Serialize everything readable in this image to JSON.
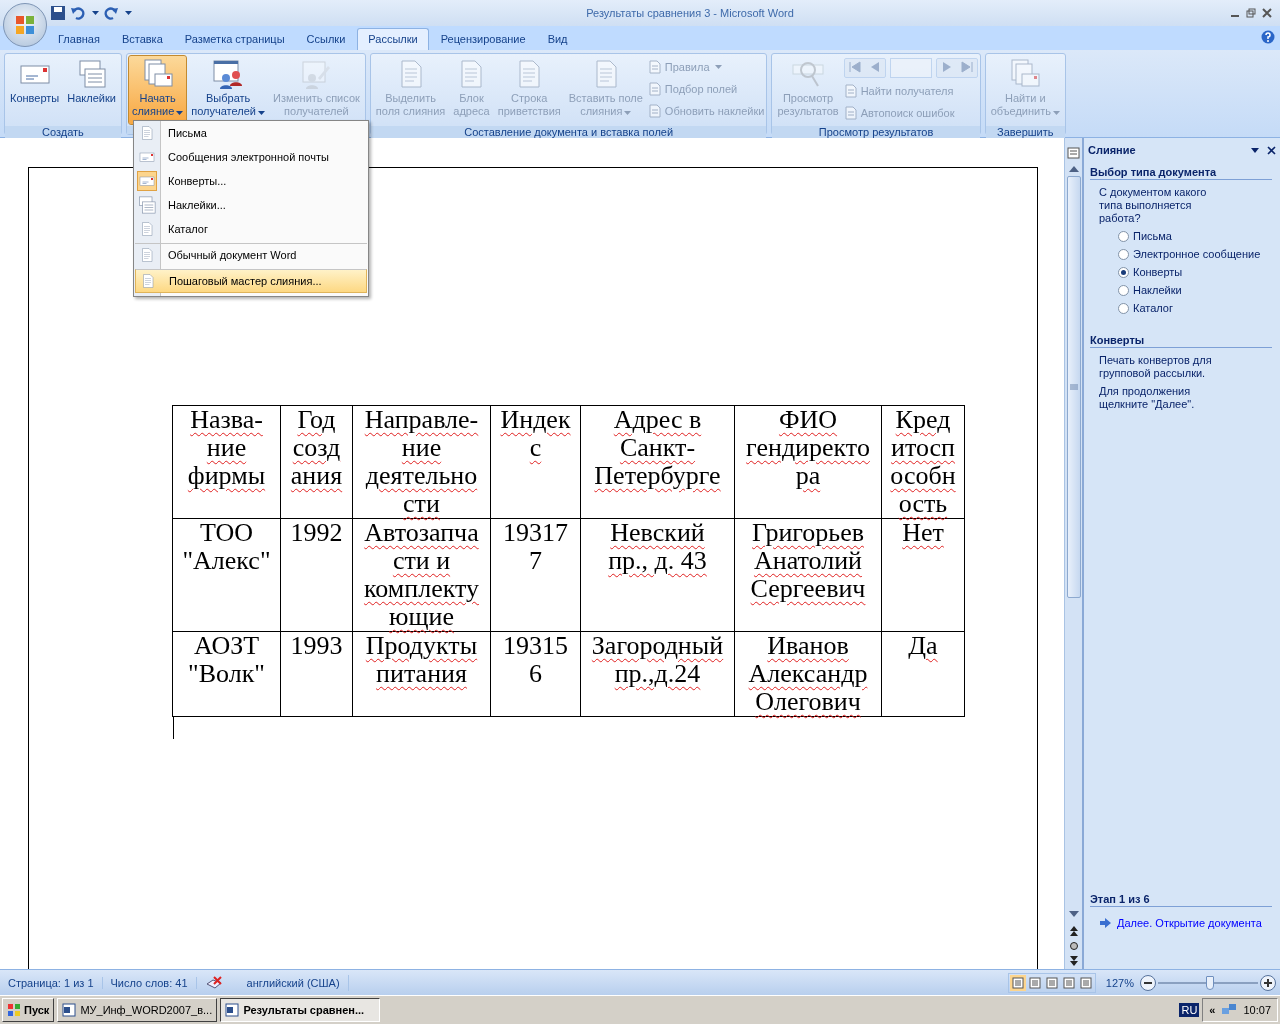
{
  "window": {
    "title": "Результаты сравнения 3 - Microsoft Word"
  },
  "tabs": [
    {
      "label": "Главная",
      "selected": false
    },
    {
      "label": "Вставка",
      "selected": false
    },
    {
      "label": "Разметка страницы",
      "selected": false
    },
    {
      "label": "Ссылки",
      "selected": false
    },
    {
      "label": "Рассылки",
      "selected": true
    },
    {
      "label": "Рецензирование",
      "selected": false
    },
    {
      "label": "Вид",
      "selected": false
    }
  ],
  "ribbon": {
    "groups": [
      {
        "label": "Создать",
        "buttons": [
          {
            "kind": "large",
            "label": "Конверты",
            "disabled": false,
            "pressed": false,
            "dropdown": false
          },
          {
            "kind": "large",
            "label": "Наклейки",
            "disabled": false,
            "pressed": false,
            "dropdown": false
          }
        ]
      },
      {
        "buttons": [
          {
            "kind": "large",
            "label": "Начать\nслияние",
            "disabled": false,
            "pressed": true,
            "dropdown": true
          },
          {
            "kind": "large",
            "label": "Выбрать\nполучателей",
            "disabled": false,
            "pressed": false,
            "dropdown": true
          },
          {
            "kind": "large",
            "label": "Изменить список\nполучателей",
            "disabled": true,
            "pressed": false,
            "dropdown": false
          }
        ]
      },
      {
        "label": "Составление документа и вставка полей",
        "buttons": [
          {
            "kind": "large",
            "label": "Выделить\nполя слияния",
            "disabled": true,
            "pressed": false,
            "dropdown": false
          },
          {
            "kind": "large",
            "label": "Блок\nадреса",
            "disabled": true,
            "pressed": false,
            "dropdown": false
          },
          {
            "kind": "large",
            "label": "Строка\nприветствия",
            "disabled": true,
            "pressed": false,
            "dropdown": false
          },
          {
            "kind": "large",
            "label": "Вставить поле\nслияния",
            "disabled": true,
            "pressed": false,
            "dropdown": true
          },
          {
            "kind": "small",
            "label": "Правила",
            "disabled": true,
            "pressed": false,
            "dropdown": true
          },
          {
            "kind": "small",
            "label": "Подбор полей",
            "disabled": true,
            "pressed": false,
            "dropdown": false
          },
          {
            "kind": "small",
            "label": "Обновить наклейки",
            "disabled": true,
            "pressed": false,
            "dropdown": false
          }
        ]
      },
      {
        "label": "Просмотр результатов",
        "buttons": [
          {
            "kind": "large",
            "label": "Просмотр\nрезультатов",
            "disabled": true,
            "pressed": false,
            "dropdown": false
          },
          {
            "kind": "navigator",
            "disabled": true
          },
          {
            "kind": "small",
            "label": "Найти получателя",
            "disabled": true,
            "pressed": false,
            "dropdown": false
          },
          {
            "kind": "small",
            "label": "Автопоиск ошибок",
            "disabled": true,
            "pressed": false,
            "dropdown": false
          }
        ]
      },
      {
        "label": "Завершить",
        "buttons": [
          {
            "kind": "large",
            "label": "Найти и\nобъединить",
            "disabled": true,
            "pressed": false,
            "dropdown": true
          }
        ]
      }
    ]
  },
  "menu": {
    "items": [
      {
        "label": "Письма",
        "selected": false,
        "checked": false,
        "separator_before": false
      },
      {
        "label": "Сообщения электронной почты",
        "selected": false,
        "checked": false,
        "separator_before": false
      },
      {
        "label": "Конверты...",
        "selected": false,
        "checked": true,
        "separator_before": false
      },
      {
        "label": "Наклейки...",
        "selected": false,
        "checked": false,
        "separator_before": false
      },
      {
        "label": "Каталог",
        "selected": false,
        "checked": false,
        "separator_before": false
      },
      {
        "label": "Обычный документ Word",
        "selected": false,
        "checked": false,
        "separator_before": true
      },
      {
        "label": "Пошаговый мастер слияния...",
        "selected": true,
        "checked": false,
        "separator_before": true
      }
    ]
  },
  "document": {
    "table": {
      "rows": [
        {
          "cells": [
            {
              "text": "Назва-ние фирмы",
              "flagged": true
            },
            {
              "text": "Год создания",
              "flagged": true
            },
            {
              "text": "Направле-ние деятельности",
              "flagged": true
            },
            {
              "text": "Индекс",
              "flagged": true
            },
            {
              "text": "Адрес в Санкт-Петербурге",
              "flagged": true
            },
            {
              "text": "ФИО гендиректора",
              "flagged": true
            },
            {
              "text": "Кредитоспособность",
              "flagged": true
            }
          ]
        },
        {
          "cells": [
            {
              "text": "ТОО \"Алекс\"",
              "flagged": false
            },
            {
              "text": "1992",
              "flagged": false
            },
            {
              "text": "Автозапчасти и комплектующие",
              "flagged": true
            },
            {
              "text": "193177",
              "flagged": false
            },
            {
              "text": "Невский пр., д. 43",
              "flagged": true
            },
            {
              "text": "Григорьев Анатолий Сергеевич",
              "flagged": true
            },
            {
              "text": "Нет",
              "flagged": true
            }
          ]
        },
        {
          "cells": [
            {
              "text": "АОЗТ \"Волк\"",
              "flagged": false
            },
            {
              "text": "1993",
              "flagged": false
            },
            {
              "text": "Продукты питания",
              "flagged": true
            },
            {
              "text": "193156",
              "flagged": false
            },
            {
              "text": "Загородный пр.,д.24",
              "flagged": true
            },
            {
              "text": "Иванов Александр Олегович",
              "flagged": true
            },
            {
              "text": "Да",
              "flagged": true
            }
          ]
        }
      ]
    }
  },
  "task_pane": {
    "title": "Слияние",
    "sections": [
      {
        "heading": "Выбор типа документа",
        "paragraphs": [
          "С документом какого типа выполняется работа?"
        ],
        "options": [
          {
            "label": "Письма",
            "selected": false
          },
          {
            "label": "Электронное сообщение",
            "selected": false
          },
          {
            "label": "Конверты",
            "selected": true
          },
          {
            "label": "Наклейки",
            "selected": false
          },
          {
            "label": "Каталог",
            "selected": false
          }
        ]
      },
      {
        "heading": "Конверты",
        "paragraphs": [
          "Печать конвертов для групповой рассылки.",
          "Для продолжения щелкните \"Далее\"."
        ]
      }
    ],
    "step": "Этап 1 из 6",
    "next_link": "Далее. Открытие документа"
  },
  "status_bar": {
    "items": [
      "Страница: 1 из 1",
      "Число слов: 41"
    ],
    "language": "английский (США)",
    "views": [
      {
        "selected": true
      },
      {
        "selected": false
      },
      {
        "selected": false
      },
      {
        "selected": false
      },
      {
        "selected": false
      }
    ],
    "zoom": "127%",
    "zoom_slider": {
      "level": 0.52
    }
  },
  "taskbar": {
    "start": "Пуск",
    "tasks": [
      {
        "label": "МУ_Инф_WORD2007_в...",
        "selected": false
      },
      {
        "label": "Результаты сравнен...",
        "selected": true
      }
    ],
    "language": "RU",
    "tray_expand": "«",
    "clock": "10:07"
  }
}
